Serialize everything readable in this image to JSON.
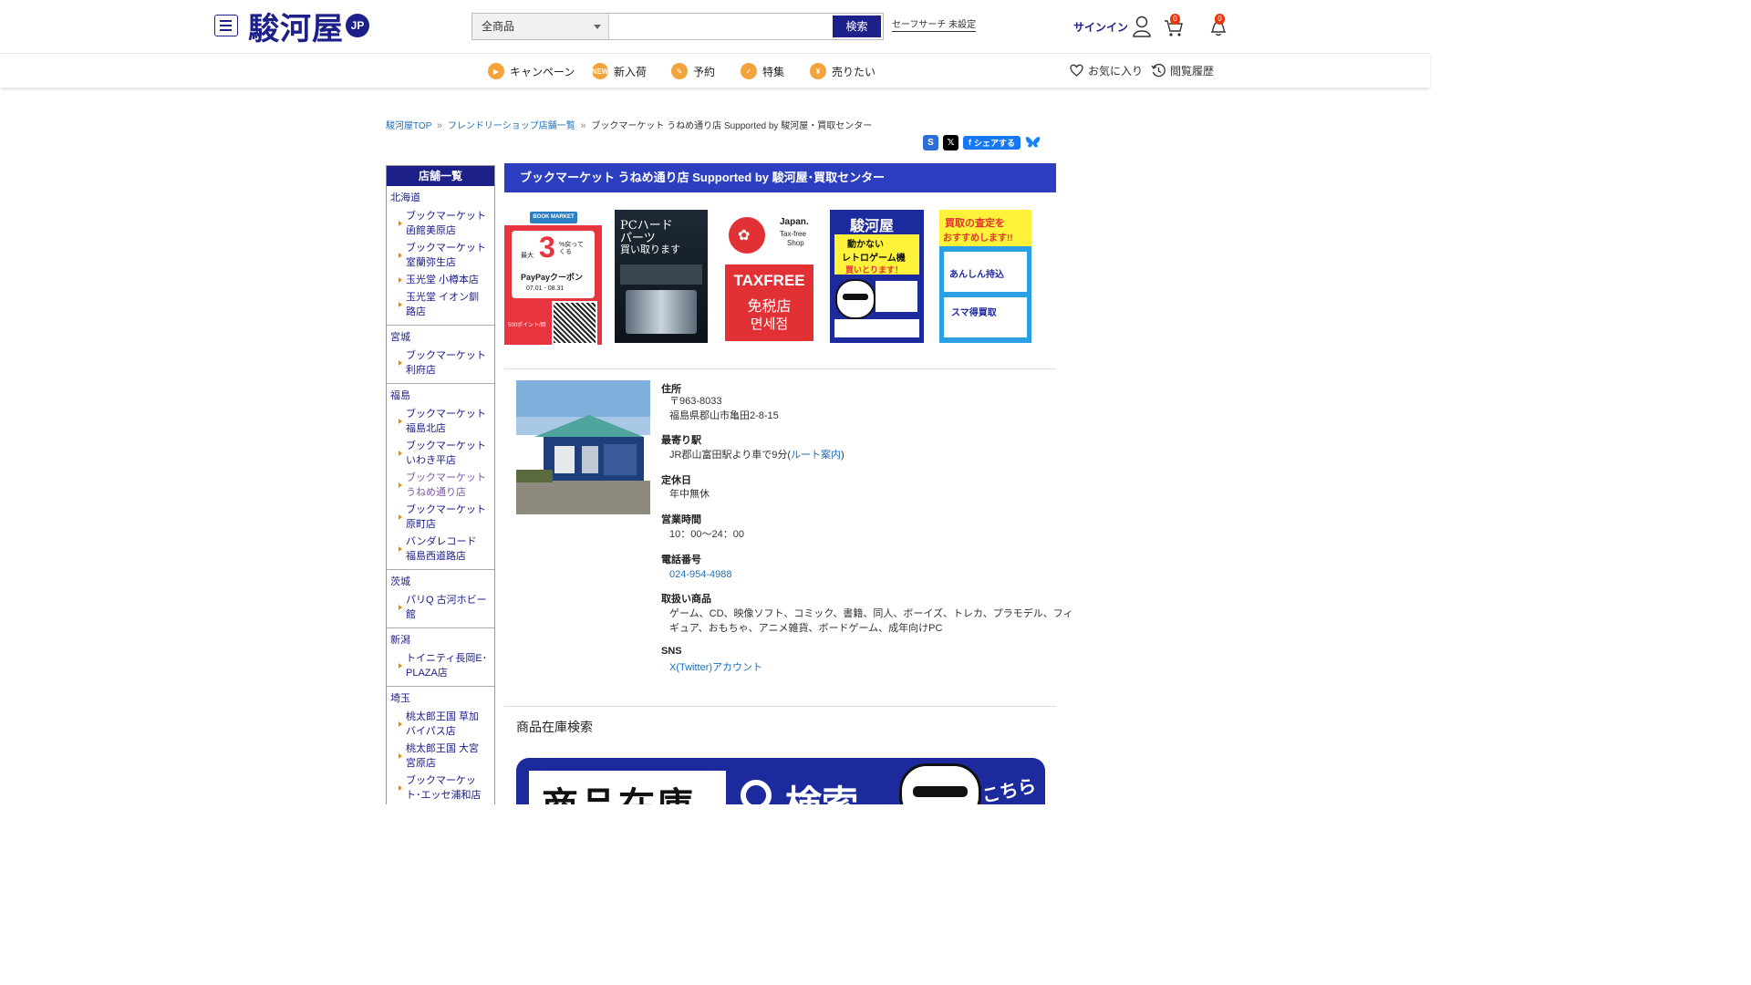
{
  "header": {
    "logo_text": "駿河屋",
    "logo_badge": "JP",
    "category_select": "全商品",
    "search_placeholder": "",
    "search_button": "検索",
    "safe_search": "セーフサーチ 未設定",
    "signin_label": "サインイン",
    "cart_count": "0",
    "notification_count": "0"
  },
  "nav": {
    "items": [
      {
        "label": "キャンペーン",
        "icon": "megaphone-icon"
      },
      {
        "label": "新入荷",
        "icon": "new-icon"
      },
      {
        "label": "予約",
        "icon": "reserve-icon"
      },
      {
        "label": "特集",
        "icon": "feature-icon"
      },
      {
        "label": "売りたい",
        "icon": "sell-icon"
      }
    ],
    "favorites_label": "お気に入り",
    "history_label": "閲覧履歴",
    "accent_color": "#f3a33b"
  },
  "breadcrumb": {
    "items": [
      "駿河屋TOP",
      "フレンドリーショップ店舗一覧",
      "ブックマーケット うねめ通り店 Supported by 駿河屋・買取センター"
    ]
  },
  "share": {
    "facebook_label": "シェアする"
  },
  "sidebar": {
    "title": "店舗一覧",
    "regions": [
      {
        "name": "北海道",
        "shops": [
          "ブックマーケット 函館美原店",
          "ブックマーケット 室蘭弥生店",
          "玉光堂 小樽本店",
          "玉光堂 イオン釧路店"
        ]
      },
      {
        "name": "宮城",
        "shops": [
          "ブックマーケット 利府店"
        ]
      },
      {
        "name": "福島",
        "shops": [
          "ブックマーケット 福島北店",
          "ブックマーケット いわき平店",
          "ブックマーケット うねめ通り店",
          "ブックマーケット原町店",
          "バンダレコード 福島西道路店"
        ]
      },
      {
        "name": "茨城",
        "shops": [
          "パリQ 古河ホビー館"
        ]
      },
      {
        "name": "新潟",
        "shops": [
          "トイニティ長岡E･PLAZA店"
        ]
      },
      {
        "name": "埼玉",
        "shops": [
          "桃太郎王国 草加バイパス店",
          "桃太郎王国 大宮宮原店",
          "ブックマーケット･エッセ浦和店"
        ]
      }
    ]
  },
  "store": {
    "title": "ブックマーケット うねめ通り店 Supported by 駿河屋･買取センター",
    "banners": {
      "paypay": {
        "brand": "BOOK MARKET",
        "line1": "最大",
        "big": "3",
        "line2": "%戻ってくる",
        "line3": "PayPayクーポン",
        "dates": "07.01 - 08.31",
        "bottom": "500ポイント/回"
      },
      "pc": {
        "line1": "PCハード",
        "line2": "パーツ",
        "line3": "買い取ります"
      },
      "taxfree": {
        "japan": "Japan.",
        "sub1": "Tax-free",
        "sub2": "Shop",
        "main": "TAXFREE",
        "jp": "免税店",
        "kr": "면세점"
      },
      "retro": {
        "logo": "駿河屋",
        "l1": "動かない",
        "l2": "レトロゲーム機",
        "l3": "買いとります！"
      },
      "smart": {
        "l1": "買取",
        "l2": "の査定を",
        "l3": "おすすめします!!",
        "l4": "あんしん持込",
        "l5": "スマ得買取"
      }
    },
    "info": {
      "address_label": "住所",
      "postal": "〒963-8033",
      "address": "福島県郡山市亀田2-8-15",
      "station_label": "最寄り駅",
      "station": "JR郡山富田駅より車で9分(",
      "route_link": "ルート案内",
      "station_close": ")",
      "holiday_label": "定休日",
      "holiday": "年中無休",
      "hours_label": "営業時間",
      "hours": "10：00〜24：00",
      "phone_label": "電話番号",
      "phone": "024-954-4988",
      "products_label": "取扱い商品",
      "products_line1": "ゲーム、CD、映像ソフト、コミック、書籍、同人、ボーイズ、トレカ、プラモデル、フィ",
      "products_line2": "ギュア、おもちゃ、アニメ雑貨、ボードゲーム、成年向けPC",
      "sns_label": "SNS",
      "sns_link": "X(Twitter)アカウント"
    },
    "stock_heading": "商品在庫検索",
    "stock_banner": {
      "text": "商品在庫",
      "search": "検索",
      "side": "こちら"
    }
  },
  "colors": {
    "brand_blue": "#1d2088",
    "title_bar": "#2b3fc0",
    "link": "#1d6fb8",
    "badge_red": "#e8380d"
  }
}
